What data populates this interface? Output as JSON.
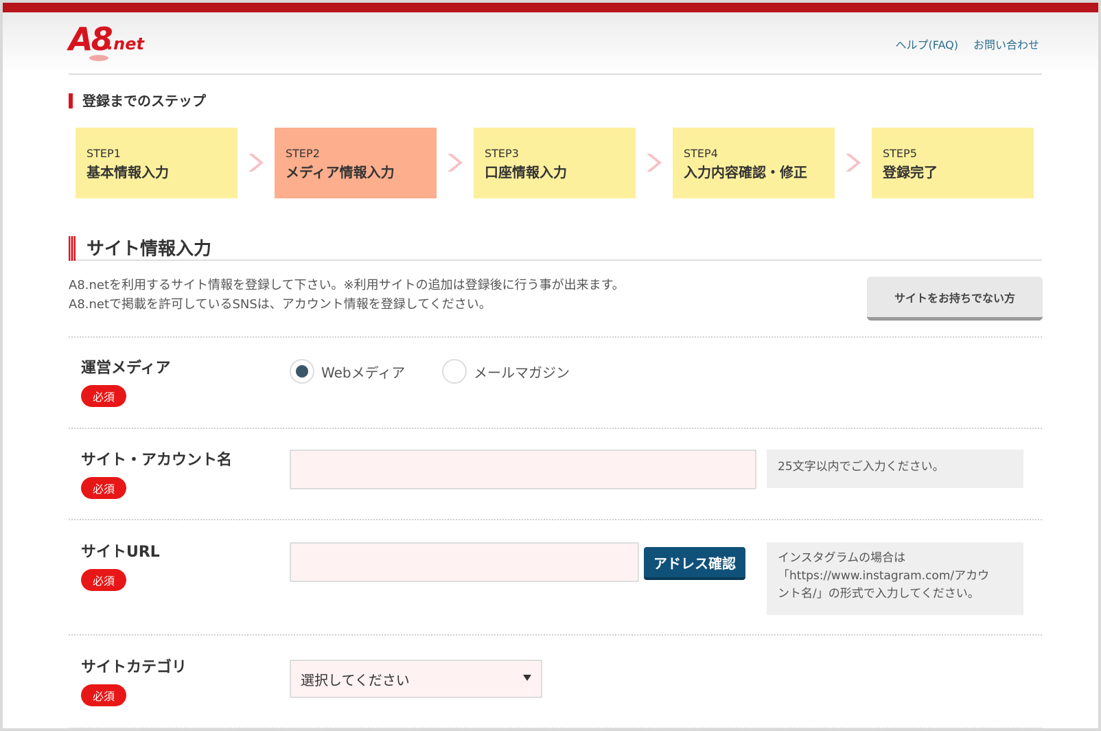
{
  "header": {
    "logo_main": "A8",
    "logo_suffix": ".net",
    "links": [
      "ヘルプ(FAQ)",
      "お問い合わせ"
    ]
  },
  "steps_title": "登録までのステップ",
  "steps": [
    {
      "no": "STEP1",
      "label": "基本情報入力",
      "active": false
    },
    {
      "no": "STEP2",
      "label": "メディア情報入力",
      "active": true
    },
    {
      "no": "STEP3",
      "label": "口座情報入力",
      "active": false
    },
    {
      "no": "STEP4",
      "label": "入力内容確認・修正",
      "active": false
    },
    {
      "no": "STEP5",
      "label": "登録完了",
      "active": false
    }
  ],
  "section_title": "サイト情報入力",
  "intro": {
    "line1": "A8.netを利用するサイト情報を登録して下さい。※利用サイトの追加は登録後に行う事が出来ます。",
    "line2": "A8.netで掲載を許可しているSNSは、アカウント情報を登録してください。"
  },
  "no_site_button": "サイトをお持ちでない方",
  "required_label": "必須",
  "form": {
    "media": {
      "label": "運営メディア",
      "options": [
        {
          "label": "Webメディア",
          "selected": true
        },
        {
          "label": "メールマガジン",
          "selected": false
        }
      ]
    },
    "site_name": {
      "label": "サイト・アカウント名",
      "value": "",
      "hint": "25文字以内でご入力ください。"
    },
    "site_url": {
      "label": "サイトURL",
      "value": "",
      "button": "アドレス確認",
      "hint_line1": "インスタグラムの場合は",
      "hint_line2": "「https://www.instagram.com/アカウ",
      "hint_line3": "ント名/」の形式で入力してください。"
    },
    "site_category": {
      "label": "サイトカテゴリ",
      "selected": "選択してください"
    }
  },
  "colors": {
    "brand_red": "#d7141e",
    "step_default": "#fdf09d",
    "step_active": "#fcae8d",
    "primary_button": "#105179",
    "input_bg": "#fff2f2"
  }
}
